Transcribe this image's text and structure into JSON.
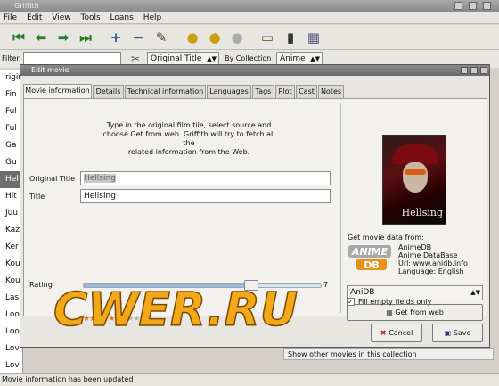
{
  "app": {
    "title": "Griffith"
  },
  "menu": [
    "File",
    "Edit",
    "View",
    "Tools",
    "Loans",
    "Help"
  ],
  "toolbar_icons": [
    "first-icon",
    "prev-icon",
    "next-icon",
    "last-icon",
    "add-icon",
    "remove-icon",
    "edit-icon",
    "loan-icon",
    "return-icon",
    "email-icon",
    "open-icon",
    "delete-db-icon",
    "export-icon"
  ],
  "filter": {
    "label": "Filter",
    "value": "",
    "field": "Original Title",
    "by_label": "By Collection",
    "collection": "Anime"
  },
  "left_list": [
    "rigin",
    "Fin",
    "Ful",
    "Ful",
    "Ga",
    "Gu",
    "Hel",
    "Hit",
    "Juu",
    "Kaz",
    "Ker",
    "Kou",
    "Kou",
    "Las",
    "Loo",
    "Loo",
    "Lov",
    "Lov",
    "Lov",
    "Lov"
  ],
  "statusbar": {
    "text": "Movie information has been updated"
  },
  "dialog": {
    "title": "Edit movie",
    "tabs": [
      "Movie information",
      "Details",
      "Technical information",
      "Languages",
      "Tags",
      "Plot",
      "Cast",
      "Notes"
    ],
    "intro_lines": [
      "Type in the original film tile, select source and",
      "choose Get from web. Griffith will try to fetch all the",
      "related information from the Web."
    ],
    "original_title_label": "Original Title",
    "original_title_value": "Hellsing",
    "title_label": "Title",
    "title_value": "Hellsing",
    "rating_label": "Rating",
    "rating_value": 7,
    "rating_max": 10,
    "rating_display": "7",
    "stars": {
      "filled": 7,
      "total": 10,
      "filled_color": "#e8781e",
      "empty_color": "#b8b8b8"
    },
    "cover_title": "Hellsing",
    "get_data_label": "Get movie data from:",
    "source_logo_text": "ANIME DB",
    "source_info": [
      "AnimeDB",
      "Anime DataBase",
      "Url: www.anidb.info",
      "Language: English"
    ],
    "source_select": "AniDB",
    "get_from_web": "Get from web",
    "fill_empty_label": "Fill empty fields only",
    "fill_empty_checked": true,
    "cancel": "Cancel",
    "save": "Save",
    "bg_status": "Show other movies in this collection"
  },
  "watermark": {
    "text": "CWER.RU"
  }
}
